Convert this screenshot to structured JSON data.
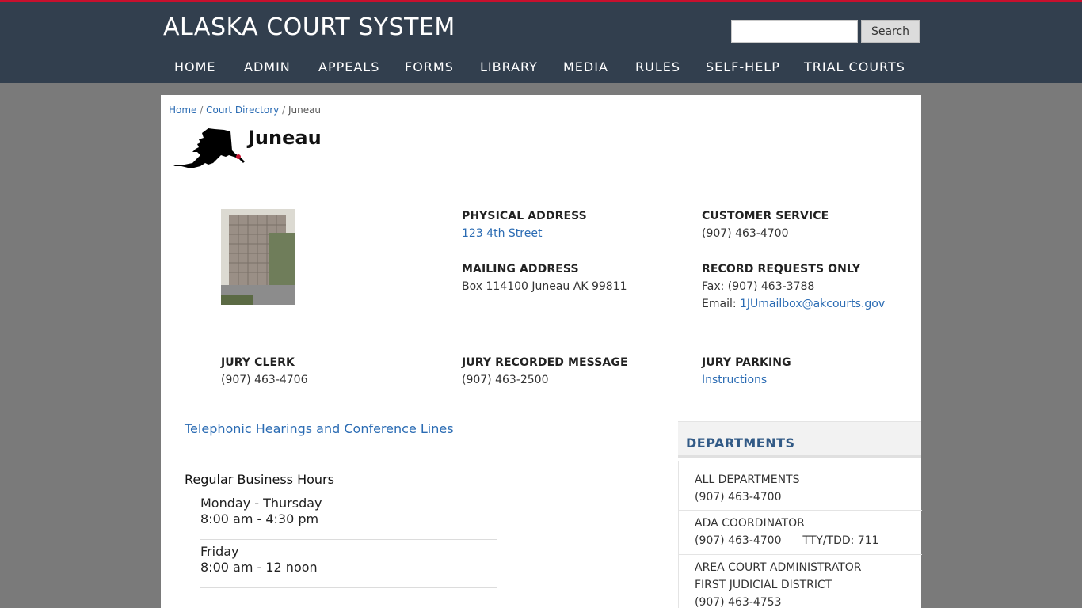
{
  "header": {
    "site_title": "ALASKA COURT SYSTEM",
    "search_button": "Search",
    "search_value": "",
    "nav": [
      "HOME",
      "ADMIN",
      "APPEALS",
      "FORMS",
      "LIBRARY",
      "MEDIA",
      "RULES",
      "SELF-HELP",
      "TRIAL COURTS"
    ]
  },
  "breadcrumb": {
    "home": "Home",
    "sep1": "/",
    "directory": "Court Directory",
    "sep2": "/",
    "current": "Juneau"
  },
  "page": {
    "title": "Juneau"
  },
  "contact": {
    "physical_label": "PHYSICAL ADDRESS",
    "physical_value": "123 4th Street",
    "mailing_label": "MAILING ADDRESS",
    "mailing_value": "Box 114100 Juneau AK 99811",
    "customer_label": "CUSTOMER SERVICE",
    "customer_value": "(907) 463-4700",
    "records_label": "RECORD REQUESTS ONLY",
    "records_fax": "Fax: (907) 463-3788",
    "records_email_prefix": "Email:",
    "records_email": "1JUmailbox@akcourts.gov",
    "jury_clerk_label": "JURY CLERK",
    "jury_clerk_value": "(907) 463-4706",
    "jury_msg_label": "JURY RECORDED MESSAGE",
    "jury_msg_value": "(907) 463-2500",
    "jury_parking_label": "JURY PARKING",
    "jury_parking_link": "Instructions"
  },
  "telephonic_link": "Telephonic Hearings and Conference Lines",
  "hours": {
    "heading": "Regular Business Hours",
    "blocks": [
      {
        "days": "Monday - Thursday",
        "time": "8:00 am - 4:30 pm"
      },
      {
        "days": "Friday",
        "time": "8:00 am - 12 noon"
      }
    ]
  },
  "departments": {
    "heading": "DEPARTMENTS",
    "items": [
      {
        "name": "ALL DEPARTMENTS",
        "phone": "(907) 463-4700",
        "extra": ""
      },
      {
        "name": "ADA COORDINATOR",
        "phone": "(907) 463-4700",
        "extra": "TTY/TDD: 711"
      },
      {
        "name": "AREA COURT ADMINISTRATOR",
        "sub": "FIRST JUDICIAL DISTRICT",
        "phone": "(907) 463-4753"
      }
    ]
  },
  "colors": {
    "header_bg": "#323f4e",
    "accent_red": "#c8102e",
    "link": "#2a6bb3",
    "page_bg": "#7a7a7a"
  }
}
